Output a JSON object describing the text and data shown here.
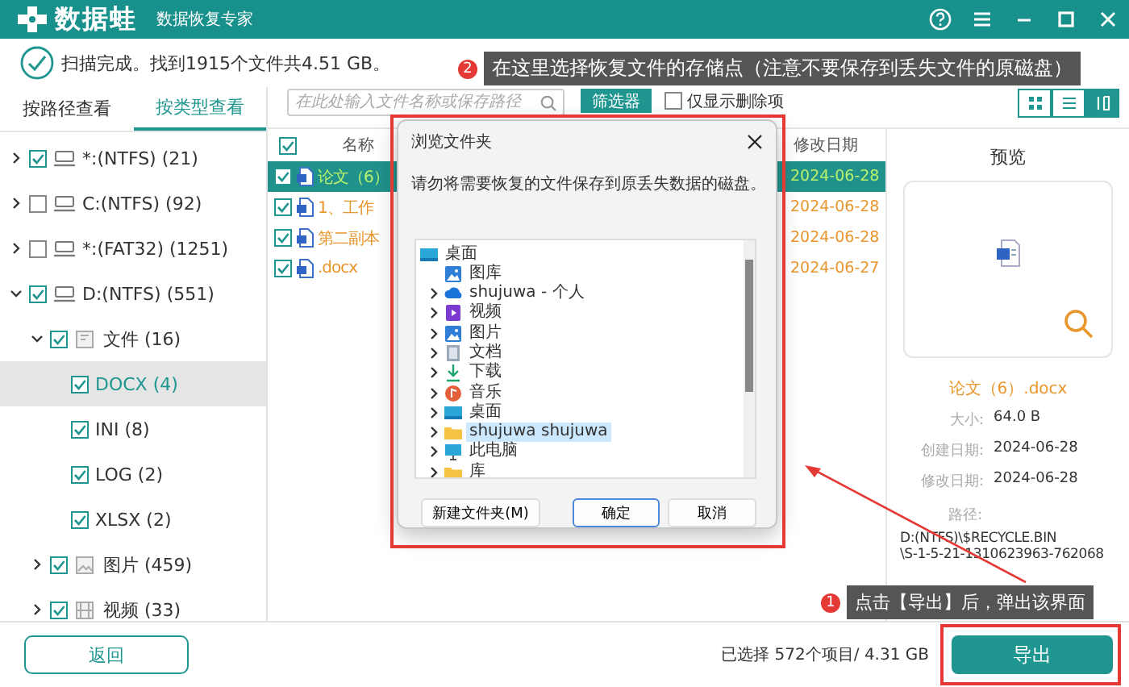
{
  "app": {
    "logo": "数据蛙",
    "subtitle": "数据恢复专家"
  },
  "scan_status": "扫描完成。找到1915个文件共4.51 GB。",
  "view_tabs": [
    {
      "label": "按路径查看",
      "selected": false
    },
    {
      "label": "按类型查看",
      "selected": true
    }
  ],
  "tree": [
    {
      "label": "*:(NTFS) (21)",
      "kind": "drive",
      "checked": true,
      "expanded": false,
      "selected": false
    },
    {
      "label": "C:(NTFS) (92)",
      "kind": "drive",
      "checked": false,
      "expanded": false,
      "selected": false
    },
    {
      "label": "*:(FAT32) (1251)",
      "kind": "drive",
      "checked": false,
      "expanded": false,
      "selected": false
    },
    {
      "label": "D:(NTFS) (551)",
      "kind": "drive",
      "checked": true,
      "expanded": true,
      "selected": false,
      "children": [
        {
          "label": "文件 (16)",
          "kind": "documents",
          "checked": true,
          "expanded": true,
          "selected": false,
          "children": [
            {
              "label": "DOCX (4)",
              "checked": true,
              "selected": true
            },
            {
              "label": "INI (8)",
              "checked": true,
              "selected": false
            },
            {
              "label": "LOG (2)",
              "checked": true,
              "selected": false
            },
            {
              "label": "XLSX (2)",
              "checked": true,
              "selected": false
            }
          ]
        },
        {
          "label": "图片 (459)",
          "kind": "images",
          "checked": true,
          "expanded": false,
          "selected": false
        },
        {
          "label": "视频 (33)",
          "kind": "videos",
          "checked": true,
          "expanded": false,
          "selected": false
        }
      ]
    }
  ],
  "toolbar": {
    "search": {
      "placeholder": "在此处输入文件名称或保存路径"
    },
    "filter_button": "筛选器",
    "deleted_only": {
      "label": "仅显示删除项",
      "checked": false
    },
    "view_modes": [
      {
        "kind": "grid",
        "selected": false
      },
      {
        "kind": "list",
        "selected": false
      },
      {
        "kind": "columns",
        "selected": true
      }
    ]
  },
  "file_table": {
    "all_checked": true,
    "columns": [
      "名称",
      "修改日期"
    ],
    "rows": [
      {
        "name": "论文（6）",
        "date": "2024-06-28",
        "checked": true,
        "selected": true
      },
      {
        "name": "1、工作",
        "date": "2024-06-28",
        "checked": true,
        "selected": false
      },
      {
        "name": "第二副本",
        "date": "2024-06-28",
        "checked": true,
        "selected": false
      },
      {
        "name": ".docx",
        "date": "2024-06-27",
        "checked": true,
        "selected": false
      }
    ]
  },
  "preview": {
    "title": "预览",
    "file_name": "论文（6）.docx",
    "details": [
      {
        "label": "大小:",
        "value": "64.0  B"
      },
      {
        "label": "创建日期:",
        "value": "2024-06-28"
      },
      {
        "label": "修改日期:",
        "value": "2024-06-28"
      }
    ],
    "path_label": "路径:",
    "path_lines": [
      "D:(NTFS)\\$RECYCLE.BIN",
      "\\S-1-5-21-1310623963-762068"
    ]
  },
  "footer": {
    "back_button": "返回",
    "selection_summary": "已选择 572个项目/ 4.31 GB",
    "export_button": "导出"
  },
  "dialog": {
    "title": "浏览文件夹",
    "message": "请勿将需要恢复的文件保存到原丢失数据的磁盘。",
    "folders": [
      {
        "label": "桌面",
        "kind": "desktop",
        "expandable": false,
        "selected": false,
        "children": [
          {
            "label": "图库",
            "kind": "gallery",
            "expandable": false,
            "selected": false
          },
          {
            "label": "shujuwa - 个人",
            "kind": "cloud",
            "expandable": true,
            "selected": false
          },
          {
            "label": "视频",
            "kind": "video",
            "expandable": true,
            "selected": false
          },
          {
            "label": "图片",
            "kind": "gallery",
            "expandable": true,
            "selected": false
          },
          {
            "label": "文档",
            "kind": "document",
            "expandable": true,
            "selected": false
          },
          {
            "label": "下载",
            "kind": "download",
            "expandable": true,
            "selected": false
          },
          {
            "label": "音乐",
            "kind": "music",
            "expandable": true,
            "selected": false
          },
          {
            "label": "桌面",
            "kind": "desktop",
            "expandable": true,
            "selected": false
          },
          {
            "label": "shujuwa shujuwa",
            "kind": "folder",
            "expandable": true,
            "selected": true
          },
          {
            "label": "此电脑",
            "kind": "computer",
            "expandable": true,
            "selected": false
          },
          {
            "label": "库",
            "kind": "folder",
            "expandable": true,
            "selected": false
          }
        ]
      }
    ],
    "buttons": [
      {
        "label": "新建文件夹(M)",
        "default": false
      },
      {
        "label": "确定",
        "default": true
      },
      {
        "label": "取消",
        "default": false
      }
    ]
  },
  "annotations": [
    {
      "number": "2",
      "text": "在这里选择恢复文件的存储点（注意不要保存到丢失文件的原磁盘）"
    },
    {
      "number": "1",
      "text": "点击【导出】后，弹出该界面"
    }
  ]
}
